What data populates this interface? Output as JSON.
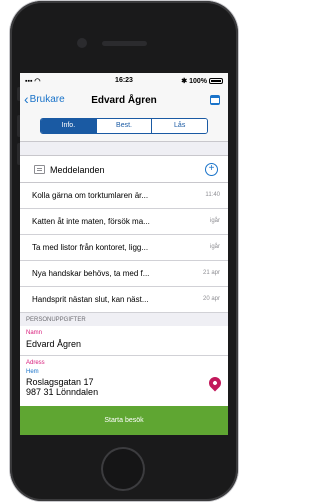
{
  "status_bar": {
    "time": "16:23",
    "battery": "100%"
  },
  "nav": {
    "back_label": "Brukare",
    "title": "Edvard Ågren"
  },
  "tabs": [
    {
      "label": "Info.",
      "active": true
    },
    {
      "label": "Best.",
      "active": false
    },
    {
      "label": "Lås",
      "active": false
    }
  ],
  "messages": {
    "header": "Meddelanden",
    "items": [
      {
        "text": "Kolla gärna om torktumlaren är...",
        "date": "11:40"
      },
      {
        "text": "Katten åt inte maten, försök ma...",
        "date": "igår"
      },
      {
        "text": "Ta med listor från kontoret, ligg...",
        "date": "igår"
      },
      {
        "text": "Nya handskar behövs, ta med f...",
        "date": "21 apr"
      },
      {
        "text": "Handsprit nästan slut, kan näst...",
        "date": "20 apr"
      }
    ]
  },
  "personal": {
    "section_title": "PERSONUPPGIFTER",
    "name_label": "Namn",
    "name_value": "Edvard Ågren",
    "address_label": "Adress",
    "address_type": "Hem",
    "street": "Roslagsgatan 17",
    "postal": "987 31 Lönndalen"
  },
  "actions": {
    "start_visit": "Starta besök"
  },
  "colors": {
    "accent": "#1a73c9",
    "tab_active": "#1a5aa3",
    "label_pink": "#d81b7a",
    "button_green": "#5fa632",
    "pin": "#c2185b"
  }
}
